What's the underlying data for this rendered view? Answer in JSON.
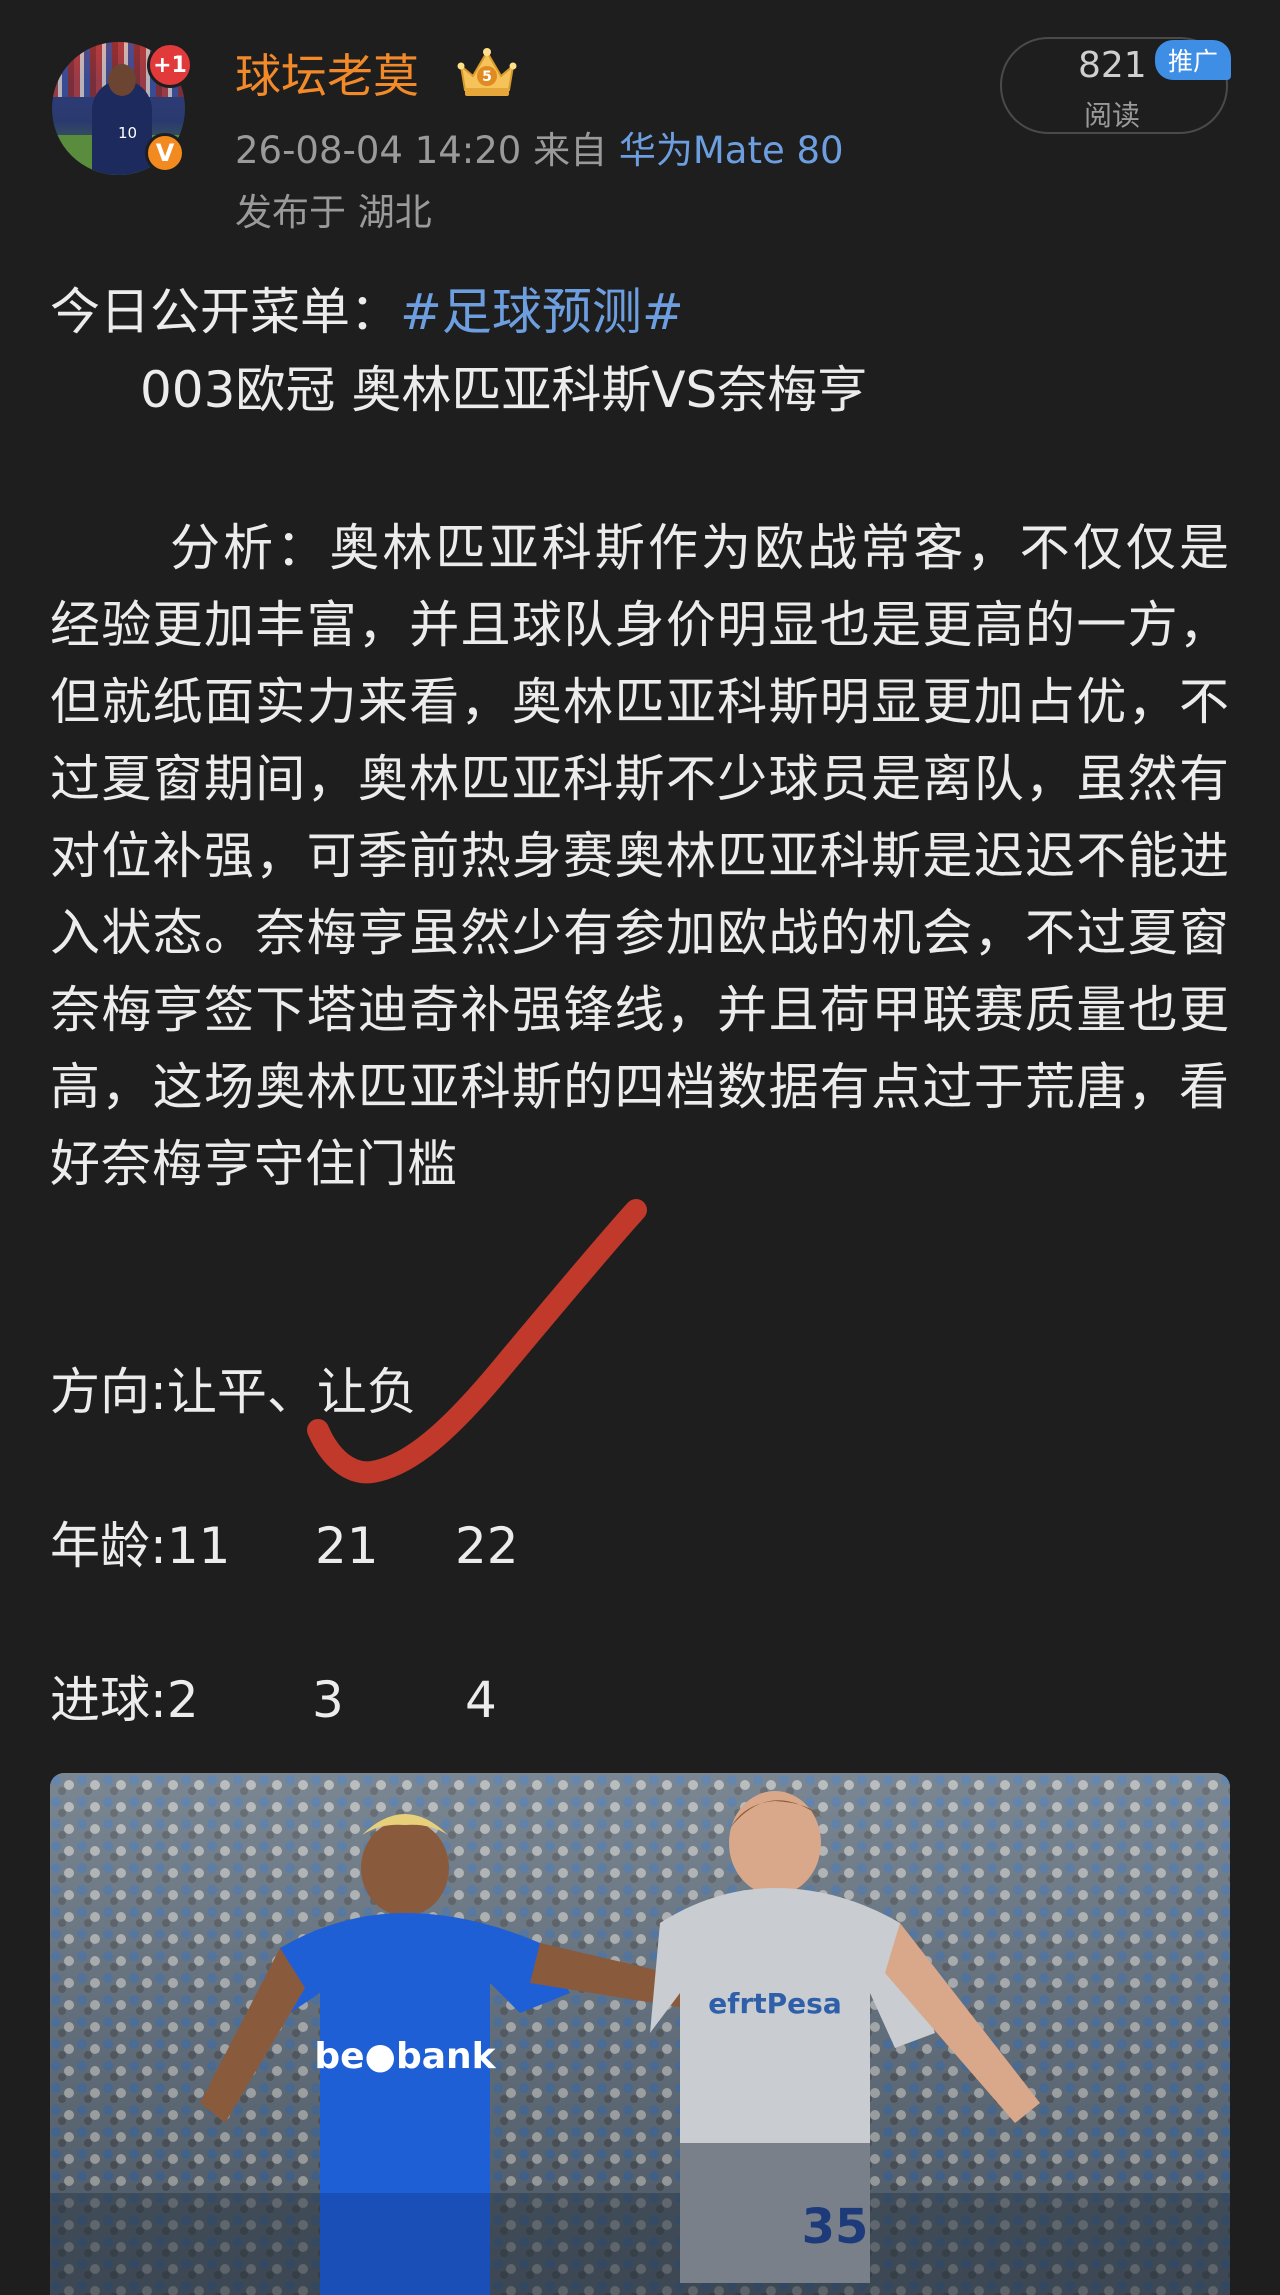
{
  "header": {
    "avatar_badge": "+1",
    "verified_badge": "V",
    "avatar_jersey_number": "10",
    "username": "球坛老莫",
    "level_badge": "5",
    "timestamp": "26-08-04 14:20",
    "from_label": "来自",
    "device": "华为Mate 80",
    "location_label": "发布于 湖北",
    "read_count": "821",
    "read_label": "阅读",
    "promo_label": "推广"
  },
  "post": {
    "menu_label": "今日公开菜单：",
    "hashtag": "#足球预测#",
    "match_line": "003欧冠 奥林匹亚科斯VS奈梅亨",
    "analysis": "分析：奥林匹亚科斯作为欧战常客，不仅仅是经验更加丰富，并且球队身价明显也是更高的一方，但就纸面实力来看，奥林匹亚科斯明显更加占优，不过夏窗期间，奥林匹亚科斯不少球员是离队，虽然有对位补强，可季前热身赛奥林匹亚科斯是迟迟不能进入状态。奈梅亨虽然少有参加欧战的机会，不过夏窗奈梅亨签下塔迪奇补强锋线，并且荷甲联赛质量也更高，这场奥林匹亚科斯的四档数据有点过于荒唐，看好奈梅亨守住门槛",
    "direction": "方向:让平、让负",
    "age_label": "年龄:11",
    "age_2": "21",
    "age_3": "22",
    "goals_label": "进球:2",
    "goals_2": "3",
    "goals_3": "4"
  },
  "photo": {
    "sponsor_left": "be●bank",
    "sponsor_right": "efrtPesa",
    "shirt_number": "35"
  },
  "colors": {
    "background": "#1e1e1e",
    "username": "#f28a2a",
    "link": "#6d9fe0",
    "checkmark": "#c0392b"
  }
}
